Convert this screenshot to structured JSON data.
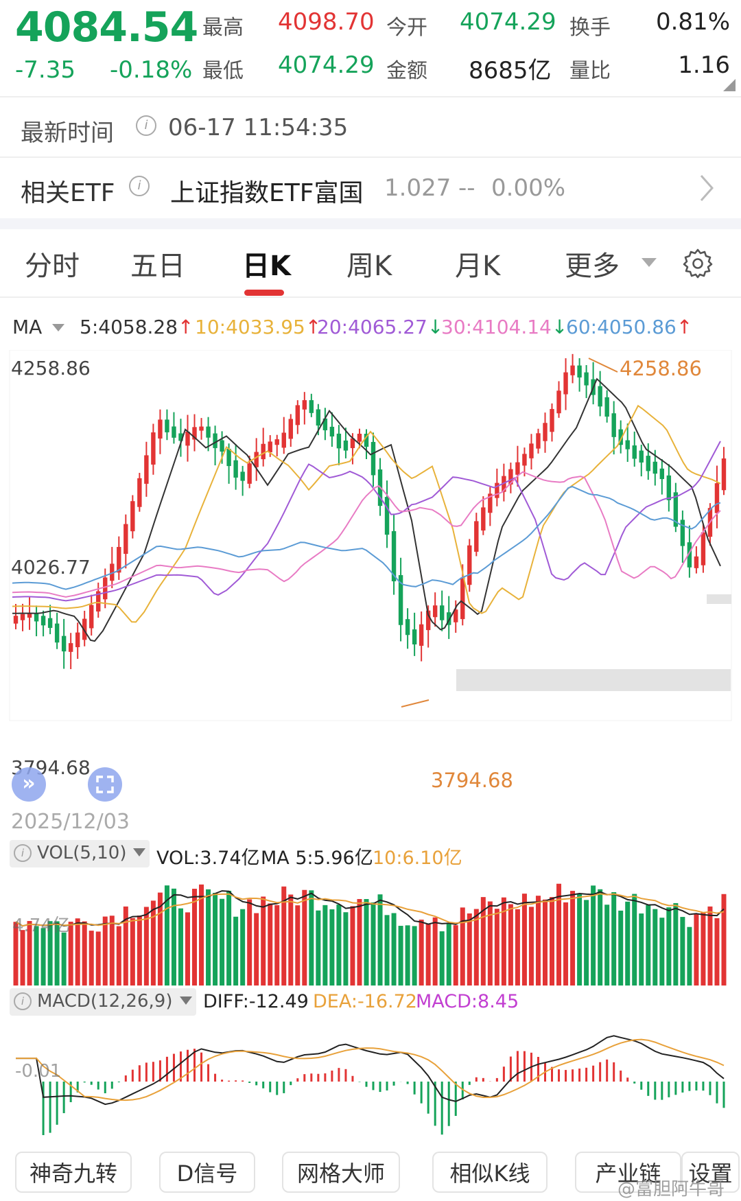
{
  "quote": {
    "price": "4084.54",
    "change": "-7.35",
    "change_pct": "-0.18%",
    "high_label": "最高",
    "high": "4098.70",
    "low_label": "最低",
    "low": "4074.29",
    "open_label": "今开",
    "open": "4074.29",
    "amount_label": "金额",
    "amount": "8685亿",
    "turnover_label": "换手",
    "turnover": "0.81%",
    "volratio_label": "量比",
    "volratio": "1.16"
  },
  "update": {
    "label": "最新时间",
    "time": "06-17 11:54:35"
  },
  "etf": {
    "label": "相关ETF",
    "name": "上证指数ETF富国",
    "price": "1.027",
    "change": "--",
    "pct": "0.00%"
  },
  "tabs": [
    "分时",
    "五日",
    "日K",
    "周K",
    "月K",
    "更多"
  ],
  "active_tab": "日K",
  "ma": {
    "label": "MA",
    "items": [
      {
        "text": "5:4058.28",
        "color": "#333333",
        "arrow": "↑",
        "arrow_color": "#e23434"
      },
      {
        "text": "10:4033.95",
        "color": "#e8b23a",
        "arrow": "↑",
        "arrow_color": "#e23434"
      },
      {
        "text": "20:4065.27",
        "color": "#a05ad6",
        "arrow": "↓",
        "arrow_color": "#15a35a"
      },
      {
        "text": "30:4104.14",
        "color": "#e87bc4",
        "arrow": "↓",
        "arrow_color": "#15a35a"
      },
      {
        "text": "60:4050.86",
        "color": "#5b9bd5",
        "arrow": "↑",
        "arrow_color": "#e23434"
      }
    ]
  },
  "axis": {
    "top": "4258.86",
    "mid": "4026.77",
    "bottom": "3794.68",
    "date": "2025/12/03"
  },
  "annotations": {
    "high": "4258.86",
    "low": "3794.68"
  },
  "vol": {
    "indicator": "VOL(5,10)",
    "vol": "VOL:3.74亿",
    "ma5": "MA 5:5.96亿",
    "ma10": "10:6.10亿",
    "axis": "4.74亿"
  },
  "macd": {
    "indicator": "MACD(12,26,9)",
    "diff": "DIFF:-12.49",
    "dea": "DEA:-16.72",
    "macd": "MACD:8.45",
    "axis": "-0.01"
  },
  "buttons": [
    "神奇九转",
    "D信号",
    "网格大师",
    "相似K线",
    "产业链",
    "设置"
  ],
  "watermark": "@富胆阿牛哥",
  "colors": {
    "up": "#e23434",
    "down": "#15a35a",
    "accent": "#e23434"
  }
}
